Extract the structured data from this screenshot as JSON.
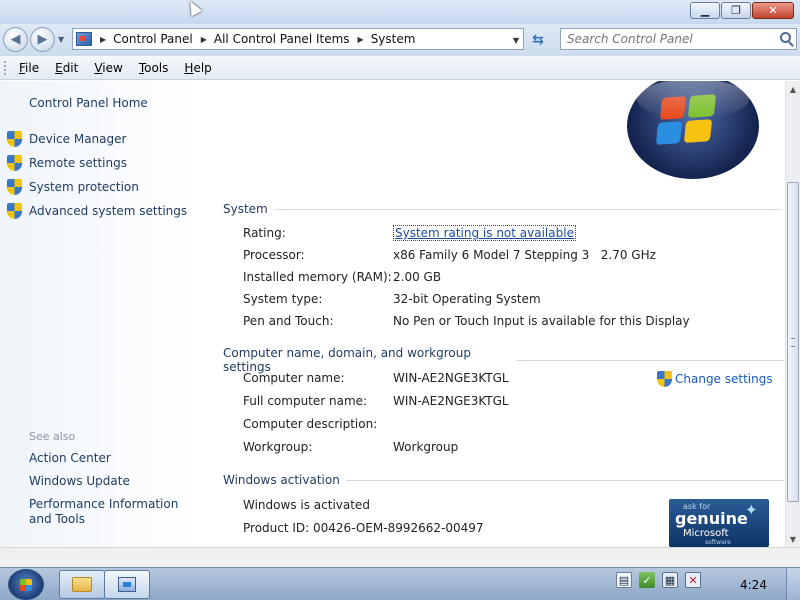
{
  "window": {
    "minimize_icon": "minimize-icon",
    "maximize_icon": "restore-icon",
    "close_icon": "close-icon"
  },
  "address_bar": {
    "breadcrumbs": [
      "Control Panel",
      "All Control Panel Items",
      "System"
    ],
    "search_placeholder": "Search Control Panel"
  },
  "menu": {
    "items": [
      {
        "underline": "F",
        "rest": "ile"
      },
      {
        "underline": "E",
        "rest": "dit"
      },
      {
        "underline": "V",
        "rest": "iew"
      },
      {
        "underline": "T",
        "rest": "ools"
      },
      {
        "underline": "H",
        "rest": "elp"
      }
    ]
  },
  "left_pane": {
    "home": "Control Panel Home",
    "tasks": [
      "Device Manager",
      "Remote settings",
      "System protection",
      "Advanced system settings"
    ],
    "see_also_heading": "See also",
    "see_also": [
      "Action Center",
      "Windows Update",
      "Performance Information and Tools"
    ]
  },
  "system": {
    "heading": "System",
    "rows": [
      {
        "label": "Rating:",
        "value": "System rating is not available"
      },
      {
        "label": "Processor:",
        "value": "x86 Family 6 Model 7 Stepping 3   2.70 GHz"
      },
      {
        "label": "Installed memory (RAM):",
        "value": "2.00 GB"
      },
      {
        "label": "System type:",
        "value": "32-bit Operating System"
      },
      {
        "label": "Pen and Touch:",
        "value": "No Pen or Touch Input is available for this Display"
      }
    ]
  },
  "computer": {
    "heading": "Computer name, domain, and workgroup settings",
    "change_settings": "Change settings",
    "rows": [
      {
        "label": "Computer name:",
        "value": "WIN-AE2NGE3KTGL"
      },
      {
        "label": "Full computer name:",
        "value": "WIN-AE2NGE3KTGL"
      },
      {
        "label": "Computer description:",
        "value": ""
      },
      {
        "label": "Workgroup:",
        "value": "Workgroup"
      }
    ]
  },
  "activation": {
    "heading": "Windows activation",
    "status": "Windows is activated",
    "product_id": "Product ID: 00426-OEM-8992662-00497",
    "badge": {
      "ask": "ask for",
      "genuine": "genuine",
      "microsoft": "Microsoft",
      "software": "software"
    }
  },
  "taskbar": {
    "clock": "4:24"
  }
}
